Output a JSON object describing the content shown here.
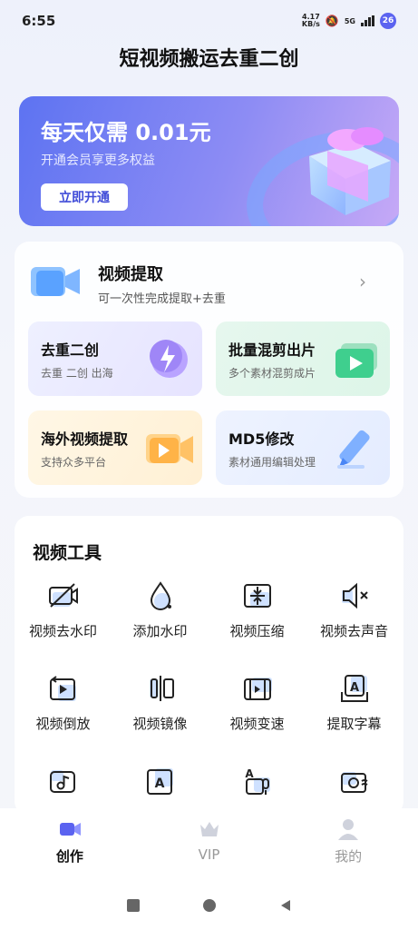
{
  "status": {
    "time": "6:55",
    "net_speed_value": "4.17",
    "net_speed_unit": "KB/s",
    "network": "5G",
    "battery": "26"
  },
  "title": "短视频搬运去重二创",
  "banner": {
    "title": "每天仅需 0.01元",
    "subtitle": "开通会员享更多权益",
    "button": "立即开通"
  },
  "extract": {
    "title": "视频提取",
    "subtitle": "可一次性完成提取+去重",
    "chevron": "›"
  },
  "tiles": [
    {
      "title": "去重二创",
      "subtitle": "去重  二创  出海"
    },
    {
      "title": "批量混剪出片",
      "subtitle": "多个素材混剪成片"
    },
    {
      "title": "海外视频提取",
      "subtitle": "支持众多平台"
    },
    {
      "title": "MD5修改",
      "subtitle": "素材通用编辑处理"
    }
  ],
  "tools": {
    "title": "视频工具",
    "items": [
      {
        "label": "视频去水印",
        "icon": "no-camera-icon"
      },
      {
        "label": "添加水印",
        "icon": "drop-icon"
      },
      {
        "label": "视频压缩",
        "icon": "compress-icon"
      },
      {
        "label": "视频去声音",
        "icon": "mute-icon"
      },
      {
        "label": "视频倒放",
        "icon": "reverse-icon"
      },
      {
        "label": "视频镜像",
        "icon": "mirror-icon"
      },
      {
        "label": "视频变速",
        "icon": "film-icon"
      },
      {
        "label": "提取字幕",
        "icon": "subtitle-icon"
      },
      {
        "label": "",
        "icon": "music-icon"
      },
      {
        "label": "",
        "icon": "text-icon"
      },
      {
        "label": "",
        "icon": "voice-icon"
      },
      {
        "label": "",
        "icon": "photo-icon"
      }
    ]
  },
  "tabs": [
    {
      "label": "创作",
      "icon": "video-tab-icon"
    },
    {
      "label": "VIP",
      "icon": "crown-icon"
    },
    {
      "label": "我的",
      "icon": "profile-icon"
    }
  ],
  "colors": {
    "accent": "#5b63f0",
    "banner_start": "#5d73f2",
    "banner_end": "#c6a9f6"
  }
}
